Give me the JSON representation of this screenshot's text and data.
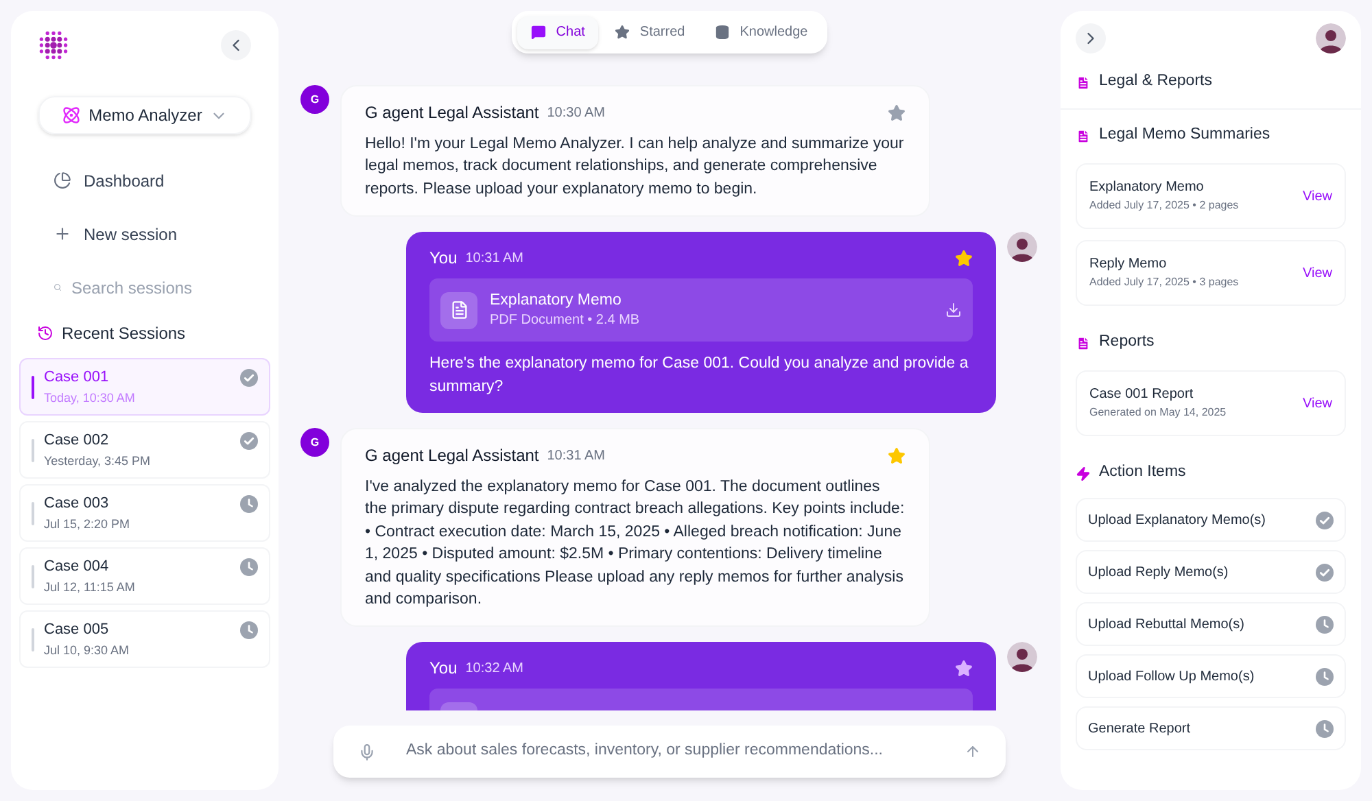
{
  "sidebar": {
    "agent_selector": "Memo Analyzer",
    "nav": [
      {
        "kind": "dashboard",
        "label": "Dashboard"
      },
      {
        "kind": "new",
        "label": "New session"
      }
    ],
    "search": {
      "placeholder": "Search sessions"
    },
    "recent_title": "Recent Sessions",
    "sessions": [
      {
        "title": "Case 001",
        "time": "Today, 10:30 AM",
        "done": true,
        "selected": true
      },
      {
        "title": "Case 002",
        "time": "Yesterday, 3:45 PM",
        "done": true,
        "selected": false
      },
      {
        "title": "Case 003",
        "time": "Jul 15, 2:20 PM",
        "done": false,
        "selected": false
      },
      {
        "title": "Case 004",
        "time": "Jul 12, 11:15 AM",
        "done": false,
        "selected": false
      },
      {
        "title": "Case 005",
        "time": "Jul 10, 9:30 AM",
        "done": false,
        "selected": false
      }
    ]
  },
  "tabs": [
    {
      "kind": "chat",
      "label": "Chat",
      "selected": true
    },
    {
      "kind": "starred",
      "label": "Starred",
      "selected": false
    },
    {
      "kind": "knowledge",
      "label": "Knowledge",
      "selected": false
    }
  ],
  "messages": [
    {
      "kind": "agent",
      "avatar": "G",
      "sender": "G agent Legal Assistant",
      "time": "10:30 AM",
      "starred": false,
      "text": "Hello! I'm your Legal Memo Analyzer. I can help analyze and summarize your legal memos, track document relationships, and generate comprehensive reports. Please upload your explanatory memo to begin."
    },
    {
      "kind": "user",
      "sender": "You",
      "time": "10:31 AM",
      "starred": true,
      "attachment": {
        "name": "Explanatory Memo",
        "meta": "PDF Document • 2.4 MB"
      },
      "text": "Here's the explanatory memo for Case 001. Could you analyze and provide a summary?"
    },
    {
      "kind": "agent",
      "avatar": "G",
      "sender": "G agent Legal Assistant",
      "time": "10:31 AM",
      "starred": true,
      "text": "I've analyzed the explanatory memo for Case 001. The document outlines the primary dispute regarding contract breach allegations. Key points include: • Contract execution date: March 15, 2025 • Alleged breach notification: June 1, 2025 • Disputed amount: $2.5M • Primary contentions: Delivery timeline and quality specifications Please upload any reply memos for further analysis and comparison."
    },
    {
      "kind": "user",
      "sender": "You",
      "time": "10:32 AM",
      "starred": false,
      "attachment_preview": true
    }
  ],
  "composer": {
    "placeholder": "Ask about sales forecasts, inventory, or supplier recommendations..."
  },
  "right_panel": {
    "title": "Legal & Reports",
    "summaries": {
      "title": "Legal Memo Summaries",
      "items": [
        {
          "name": "Explanatory Memo",
          "meta": "Added July 17, 2025 • 2 pages",
          "action": "View"
        },
        {
          "name": "Reply Memo",
          "meta": "Added July 17, 2025 • 3 pages",
          "action": "View"
        }
      ]
    },
    "reports": {
      "title": "Reports",
      "items": [
        {
          "name": "Case 001 Report",
          "meta": "Generated on May 14, 2025",
          "action": "View"
        }
      ]
    },
    "actions": {
      "title": "Action Items",
      "items": [
        {
          "label": "Upload Explanatory Memo(s)",
          "done": true
        },
        {
          "label": "Upload Reply Memo(s)",
          "done": true
        },
        {
          "label": "Upload Rebuttal Memo(s)",
          "done": false
        },
        {
          "label": "Upload Follow Up Memo(s)",
          "done": false
        },
        {
          "label": "Generate Report",
          "done": false
        }
      ]
    }
  }
}
